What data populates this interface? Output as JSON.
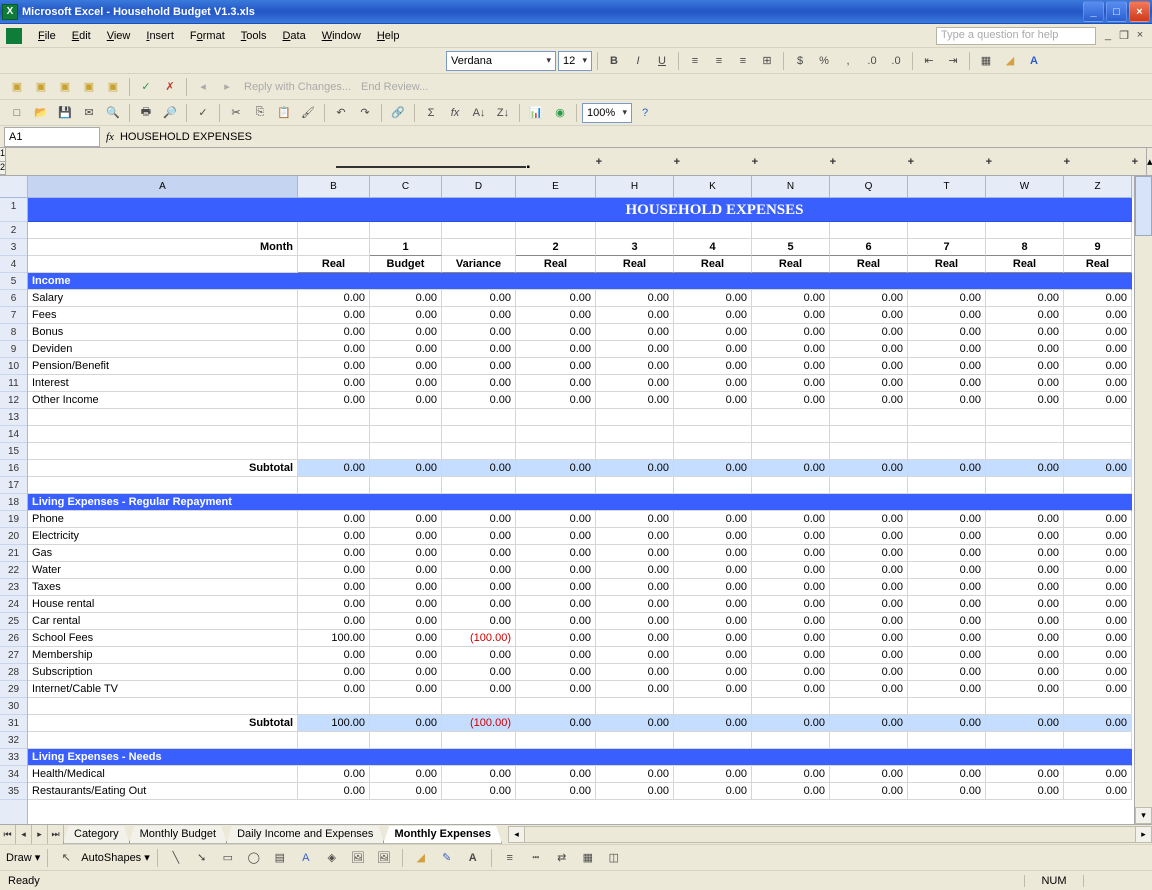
{
  "window": {
    "title": "Microsoft Excel - Household Budget V1.3.xls"
  },
  "menu": {
    "file": "File",
    "edit": "Edit",
    "view": "View",
    "insert": "Insert",
    "format": "Format",
    "tools": "Tools",
    "data": "Data",
    "window": "Window",
    "help": "Help",
    "helpbox": "Type a question for help"
  },
  "fmtbar": {
    "font": "Verdana",
    "size": "12"
  },
  "review": {
    "reply": "Reply with Changes...",
    "end": "End Review..."
  },
  "zoom": "100%",
  "namebox": "A1",
  "fx": "fx",
  "formula": "HOUSEHOLD EXPENSES",
  "cols": [
    "A",
    "B",
    "C",
    "D",
    "E",
    "H",
    "K",
    "N",
    "Q",
    "T",
    "W",
    "Z"
  ],
  "outline": [
    "1",
    "2"
  ],
  "sheet": {
    "title": "HOUSEHOLD EXPENSES",
    "month_label": "Month",
    "months": [
      "1",
      "2",
      "3",
      "4",
      "5",
      "6",
      "7",
      "8",
      "9"
    ],
    "hdr_row": [
      "Real",
      "Budget",
      "Variance",
      "Real",
      "Real",
      "Real",
      "Real",
      "Real",
      "Real",
      "Real",
      "Real"
    ],
    "sec_income": "Income",
    "income_rows": [
      "Salary",
      "Fees",
      "Bonus",
      "Deviden",
      "Pension/Benefit",
      "Interest",
      "Other Income"
    ],
    "income_vals_row": [
      "0.00",
      "0.00",
      "0.00",
      "0.00",
      "0.00",
      "0.00",
      "0.00",
      "0.00",
      "0.00",
      "0.00",
      "0.00"
    ],
    "subtotal": "Subtotal",
    "income_sub": [
      "0.00",
      "0.00",
      "0.00",
      "0.00",
      "0.00",
      "0.00",
      "0.00",
      "0.00",
      "0.00",
      "0.00",
      "0.00"
    ],
    "sec_regular": "Living Expenses - Regular Repayment",
    "reg_rows": [
      "Phone",
      "Electricity",
      "Gas",
      "Water",
      "Taxes",
      "House rental",
      "Car rental",
      "School Fees",
      "Membership",
      "Subscription",
      "Internet/Cable TV"
    ],
    "reg_school": [
      "100.00",
      "0.00",
      "(100.00)",
      "0.00",
      "0.00",
      "0.00",
      "0.00",
      "0.00",
      "0.00",
      "0.00",
      "0.00"
    ],
    "reg_sub": [
      "100.00",
      "0.00",
      "(100.00)",
      "0.00",
      "0.00",
      "0.00",
      "0.00",
      "0.00",
      "0.00",
      "0.00",
      "0.00"
    ],
    "sec_needs": "Living Expenses - Needs",
    "needs_rows": [
      "Health/Medical",
      "Restaurants/Eating Out"
    ]
  },
  "tabs": [
    "Category",
    "Monthly Budget",
    "Daily Income and Expenses",
    "Monthly Expenses"
  ],
  "active_tab": "Monthly Expenses",
  "draw": {
    "label": "Draw",
    "autoshapes": "AutoShapes"
  },
  "status": {
    "ready": "Ready",
    "num": "NUM"
  }
}
